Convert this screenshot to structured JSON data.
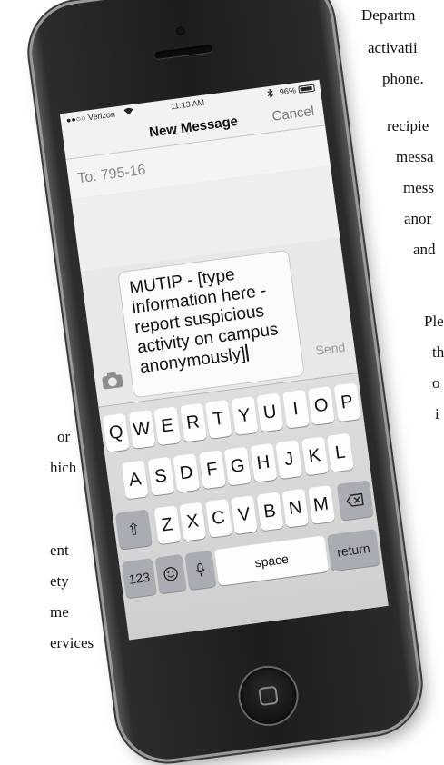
{
  "document": {
    "right_lines": [
      "Departm",
      "activatii",
      "phone.",
      "recipie",
      "messa",
      "mess",
      "anor",
      "and",
      "Ple",
      "th",
      "o",
      "i"
    ],
    "left_lines": [
      "or",
      "hich",
      "ent",
      "ety",
      "me",
      "ervices"
    ]
  },
  "phone": {
    "status_bar": {
      "carrier": "●●○○ Verizon",
      "wifi_icon": "wifi",
      "time": "11:13 AM",
      "bluetooth_icon": "bluetooth",
      "battery": "96%"
    },
    "nav": {
      "title": "New Message",
      "cancel": "Cancel"
    },
    "to_field": {
      "value": "To: 795-16"
    },
    "message": {
      "lines": [
        "MUTIP - [type",
        "information here -",
        "report suspicious",
        "activity on campus",
        "anonymously]"
      ]
    },
    "send": "Send",
    "keyboard": {
      "row1": [
        "Q",
        "W",
        "E",
        "R",
        "T",
        "Y",
        "U",
        "I",
        "O",
        "P"
      ],
      "row2": [
        "A",
        "S",
        "D",
        "F",
        "G",
        "H",
        "J",
        "K",
        "L"
      ],
      "row3": [
        "Z",
        "X",
        "C",
        "V",
        "B",
        "N",
        "M"
      ],
      "numbers": "123",
      "space": "space",
      "return": "return"
    }
  }
}
